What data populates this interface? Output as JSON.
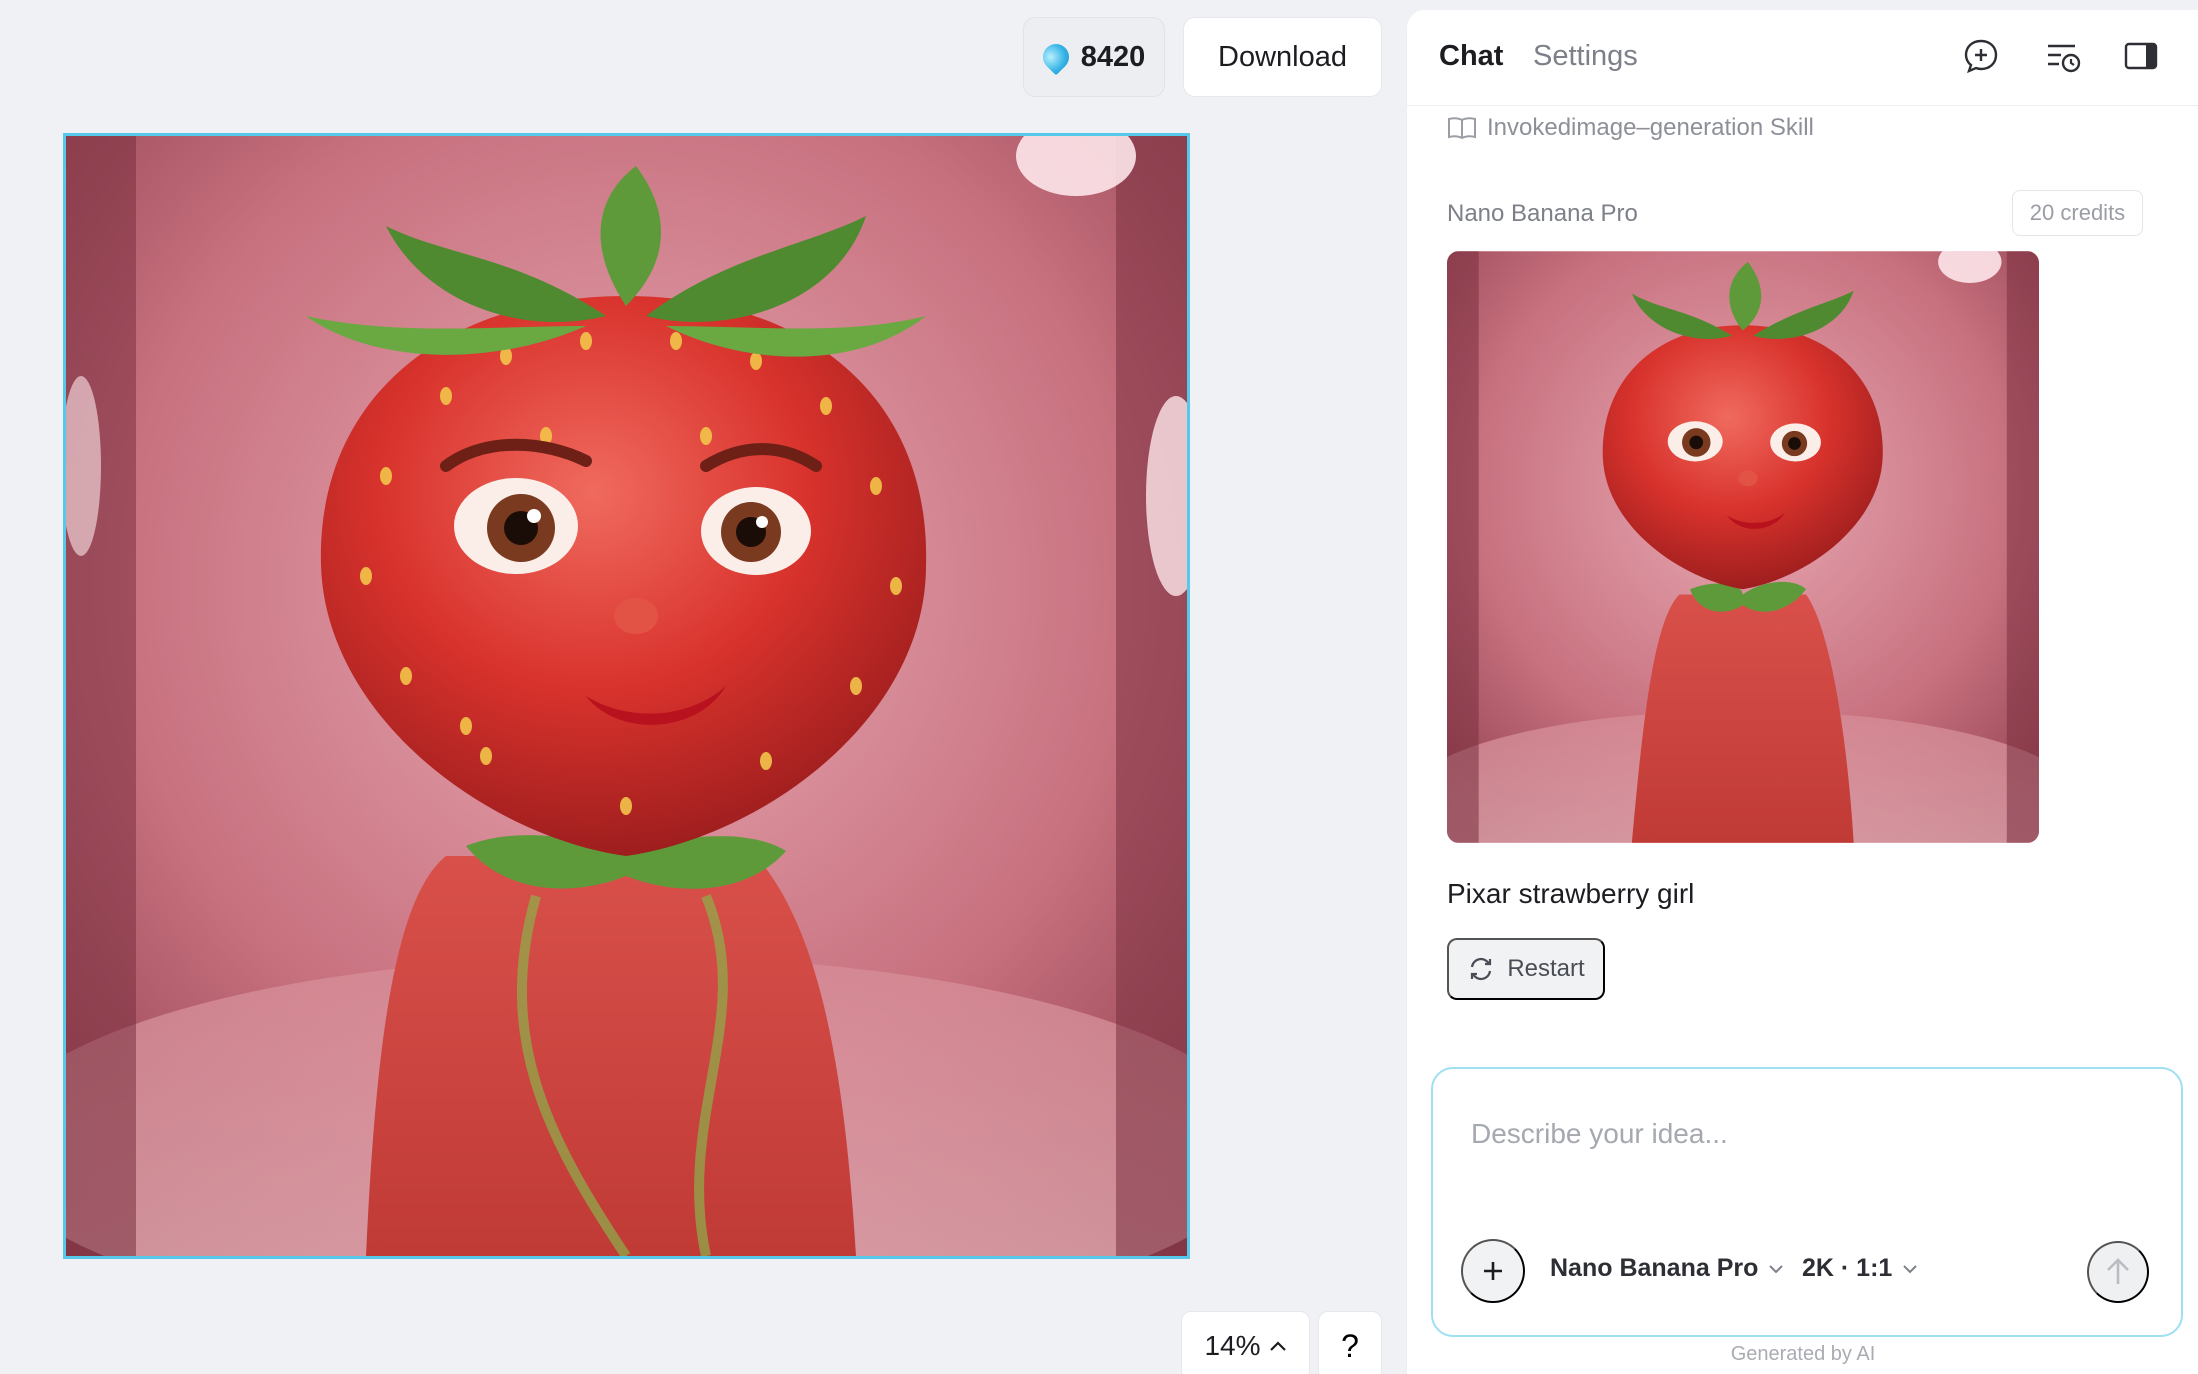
{
  "toolbar": {
    "credits": "8420",
    "download_label": "Download"
  },
  "canvas": {
    "zoom": "14%",
    "help_label": "?"
  },
  "panel": {
    "tabs": [
      {
        "label": "Chat",
        "active": true
      },
      {
        "label": "Settings",
        "active": false
      }
    ],
    "icons": [
      "new-chat-icon",
      "history-icon",
      "toggle-panel-icon"
    ],
    "skill_text": "Invokedimage–generation Skill",
    "model_name": "Nano Banana Pro",
    "credits_cost": "20 credits",
    "prompt": "Pixar strawberry girl",
    "restart_label": "Restart"
  },
  "composer": {
    "placeholder": "Describe your idea...",
    "model_option": "Nano Banana Pro",
    "ratio_option": "2K · 1:1"
  },
  "footer": {
    "note": "Generated by AI"
  },
  "colors": {
    "accent_border": "#56c9ea",
    "background": "#f0f1f4",
    "panel": "#ffffff"
  }
}
